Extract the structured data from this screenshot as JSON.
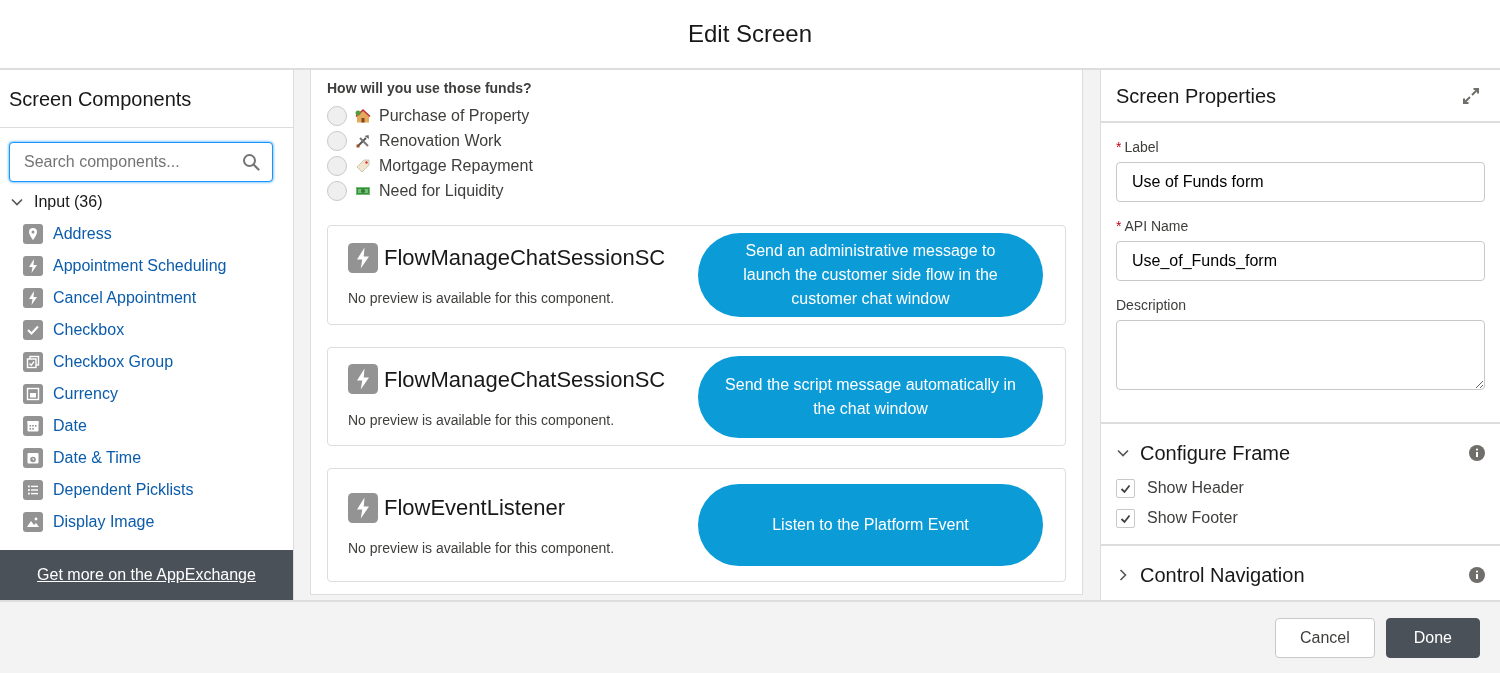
{
  "window": {
    "title": "Edit Screen"
  },
  "components_panel": {
    "title": "Screen Components",
    "search": {
      "placeholder": "Search components..."
    },
    "group": {
      "label": "Input (36)",
      "expanded": true,
      "items": [
        {
          "label": "Address",
          "kind": "location"
        },
        {
          "label": "Appointment Scheduling",
          "kind": "bolt"
        },
        {
          "label": "Cancel Appointment",
          "kind": "bolt"
        },
        {
          "label": "Checkbox",
          "kind": "check"
        },
        {
          "label": "Checkbox Group",
          "kind": "group"
        },
        {
          "label": "Currency",
          "kind": "currency"
        },
        {
          "label": "Date",
          "kind": "date"
        },
        {
          "label": "Date & Time",
          "kind": "datetime"
        },
        {
          "label": "Dependent Picklists",
          "kind": "list"
        },
        {
          "label": "Display Image",
          "kind": "image"
        }
      ]
    },
    "appexchange": "Get more on the AppExchange"
  },
  "canvas": {
    "question": "How will you use those funds?",
    "options": [
      {
        "label": "Purchase of Property",
        "kind": "house",
        "selected": false
      },
      {
        "label": "Renovation Work",
        "kind": "tools",
        "selected": false
      },
      {
        "label": "Mortgage Repayment",
        "kind": "tag",
        "selected": false
      },
      {
        "label": "Need for Liquidity",
        "kind": "money",
        "selected": false
      }
    ],
    "components": [
      {
        "name": "FlowManageChatSessionSC",
        "note": "No preview is available for this component.",
        "callout": "Send an administrative message to launch the customer side flow in the customer chat window"
      },
      {
        "name": "FlowManageChatSessionSC",
        "note": "No preview is available for this component.",
        "callout": "Send the script message automatically in the chat window"
      },
      {
        "name": "FlowEventListener",
        "note": "No preview is available for this component.",
        "callout": "Listen to the Platform Event"
      }
    ]
  },
  "properties_panel": {
    "title": "Screen Properties",
    "fields": [
      {
        "label": "Label",
        "required_marker": "*",
        "kind": "input",
        "value": "Use of Funds form"
      },
      {
        "label": "API Name",
        "required_marker": "*",
        "kind": "input",
        "value": "Use_of_Funds_form"
      },
      {
        "label": "Description",
        "kind": "textarea"
      }
    ],
    "sections": [
      {
        "title": "Configure Frame",
        "expanded": true,
        "checkboxes": [
          {
            "label": "Show Header",
            "checked": true
          },
          {
            "label": "Show Footer",
            "checked": true
          }
        ]
      },
      {
        "title": "Control Navigation",
        "expanded": false
      }
    ]
  },
  "footer": {
    "buttons": [
      {
        "label": "Cancel",
        "kind": "neutral"
      },
      {
        "label": "Done",
        "kind": "brand"
      }
    ]
  }
}
